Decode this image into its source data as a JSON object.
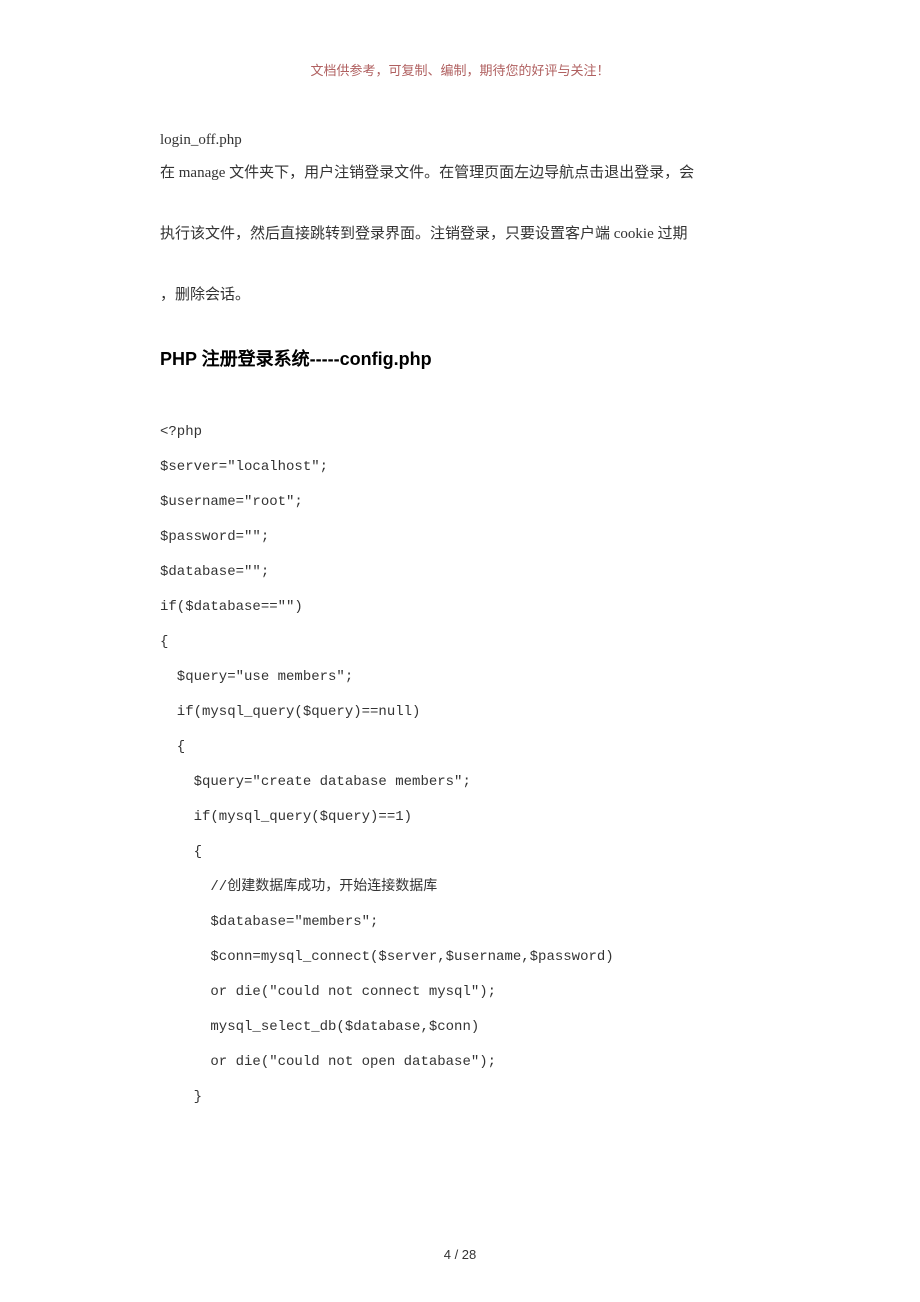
{
  "header": {
    "note": "文档供参考，可复制、编制，期待您的好评与关注！"
  },
  "content": {
    "line1": "login_off.php",
    "para1": "在 manage 文件夹下，用户注销登录文件。在管理页面左边导航点击退出登录，会",
    "para2": "执行该文件，然后直接跳转到登录界面。注销登录，只要设置客户端 cookie 过期",
    "para3": "，删除会话。",
    "heading": "PHP 注册登录系统-----config.php",
    "code": "<?php\n$server=\"localhost\";\n$username=\"root\";\n$password=\"\";\n$database=\"\";\nif($database==\"\")\n{\n  $query=\"use members\";\n  if(mysql_query($query)==null)\n  {\n    $query=\"create database members\";\n    if(mysql_query($query)==1)\n    {\n      //创建数据库成功，开始连接数据库\n      $database=\"members\";\n      $conn=mysql_connect($server,$username,$password)\n      or die(\"could not connect mysql\");\n      mysql_select_db($database,$conn)\n      or die(\"could not open database\");\n    }"
  },
  "footer": {
    "pageInfo": "4 / 28"
  }
}
